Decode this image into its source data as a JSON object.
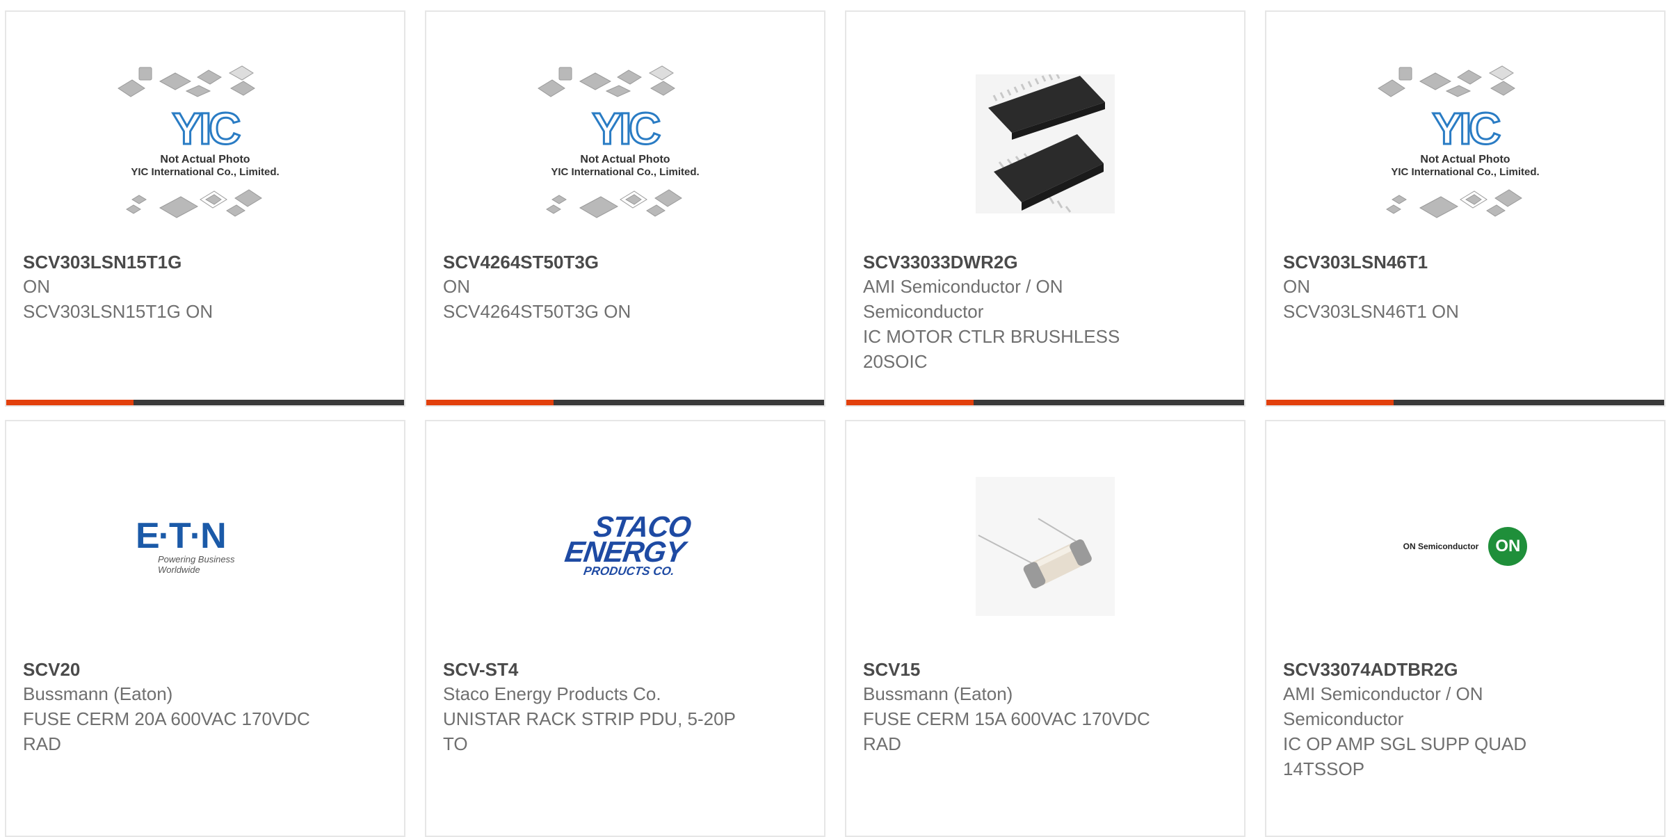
{
  "colors": {
    "accent": "#e2400c",
    "bar": "#3a3a3a",
    "eaton_blue": "#1b5aa8",
    "on_green": "#1f8f3a"
  },
  "placeholder": {
    "logo": "YIC",
    "line1": "Not Actual Photo",
    "line2": "YIC International Co., Limited."
  },
  "products": [
    {
      "part": "SCV303LSN15T1G",
      "maker": "ON",
      "desc": "SCV303LSN15T1G ON",
      "image": "yic-placeholder"
    },
    {
      "part": "SCV4264ST50T3G",
      "maker": "ON",
      "desc": "SCV4264ST50T3G ON",
      "image": "yic-placeholder"
    },
    {
      "part": "SCV33033DWR2G",
      "maker": "AMI Semiconductor / ON Semiconductor",
      "desc": "IC MOTOR CTLR BRUSHLESS 20SOIC",
      "image": "soic-chip-photo"
    },
    {
      "part": "SCV303LSN46T1",
      "maker": "ON",
      "desc": "SCV303LSN46T1 ON",
      "image": "yic-placeholder"
    },
    {
      "part": "SCV20",
      "maker": "Bussmann (Eaton)",
      "desc": "FUSE CERM 20A 600VAC 170VDC RAD",
      "image": "eaton-logo"
    },
    {
      "part": "SCV-ST4",
      "maker": "Staco Energy Products Co.",
      "desc": "UNISTAR RACK STRIP PDU, 5-20P TO",
      "image": "staco-logo"
    },
    {
      "part": "SCV15",
      "maker": "Bussmann (Eaton)",
      "desc": "FUSE CERM 15A 600VAC 170VDC RAD",
      "image": "fuse-photo"
    },
    {
      "part": "SCV33074ADTBR2G",
      "maker": "AMI Semiconductor / ON Semiconductor",
      "desc": "IC OP AMP SGL SUPP QUAD 14TSSOP",
      "image": "on-semi-logo"
    }
  ],
  "logos": {
    "eaton": {
      "name": "E·T·N",
      "tagline": "Powering Business Worldwide"
    },
    "staco": {
      "line1": "STACO",
      "line2": "ENERGY",
      "line3": "PRODUCTS CO."
    },
    "onsemi": {
      "text": "ON Semiconductor",
      "badge": "ON"
    }
  }
}
